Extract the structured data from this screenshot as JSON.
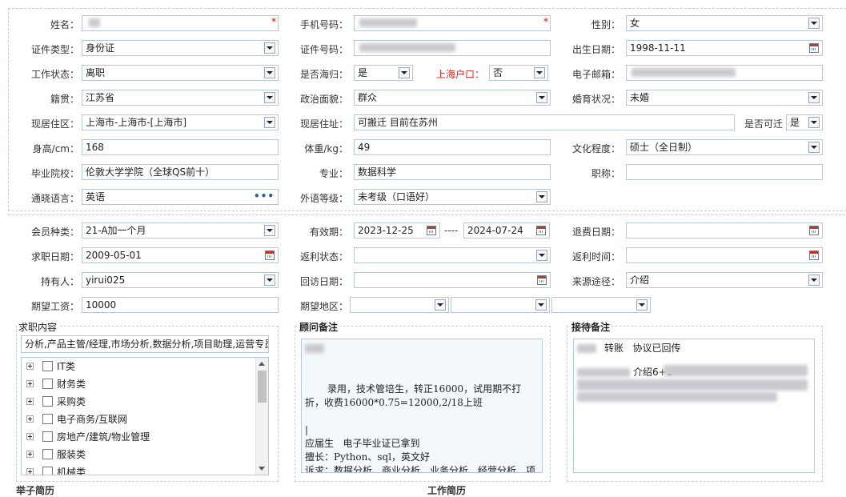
{
  "labels": {
    "name": "姓名：",
    "phone": "手机号码：",
    "gender": "性别：",
    "id_type": "证件类型：",
    "id_number": "证件号码：",
    "birthdate": "出生日期：",
    "work_status": "工作状态：",
    "returnee": "是否海归：",
    "shanghai_hukou": "上海户口：",
    "email": "电子邮箱：",
    "native_place": "籍贯：",
    "political_status": "政治面貌：",
    "marital_status": "婚育状况：",
    "current_area": "现居住区：",
    "current_address": "现居住址：",
    "relocatable": "是否可迁",
    "height": "身高/cm：",
    "weight": "体重/kg：",
    "education": "文化程度：",
    "school": "毕业院校：",
    "major": "专业：",
    "title": "职称：",
    "language": "通晓语言：",
    "foreign_level": "外语等级：",
    "member_type": "会员种类：",
    "validity": "有效期：",
    "refund_date": "退费日期：",
    "job_date": "求职日期：",
    "rebate_status": "返利状态：",
    "rebate_time": "返利时间：",
    "holder": "持有人：",
    "visit_date": "回访日期：",
    "source": "来源途径：",
    "salary": "期望工资：",
    "area": "期望地区：",
    "validity_sep": "----"
  },
  "values": {
    "name": "",
    "phone": "",
    "gender": "女",
    "id_type": "身份证",
    "id_number": "",
    "birthdate": "1998-11-11",
    "work_status": "离职",
    "returnee": "是",
    "shanghai_hukou": "否",
    "email": "",
    "native_place": "江苏省",
    "political_status": "群众",
    "marital_status": "未婚",
    "current_area": "上海市-上海市-[上海市]",
    "current_address": "可搬迁  目前在苏州",
    "relocatable": "是",
    "height": "168",
    "weight": "49",
    "education": "硕士（全日制）",
    "school": "伦敦大学学院（全球QS前十）",
    "major": "数据科学",
    "title": "",
    "language": "英语",
    "foreign_level": "未考级（口语好）",
    "member_type": "21-A加一个月",
    "validity_start": "2023-12-25",
    "validity_end": "2024-07-24",
    "refund_date": "",
    "job_date": "2009-05-01",
    "rebate_status": "",
    "rebate_time": "",
    "holder": "yirui025",
    "visit_date": "",
    "source": "介绍",
    "salary": "10000",
    "area_1": "",
    "area_2": "",
    "area_3": ""
  },
  "job_intent": {
    "title": "求职内容",
    "summary": "分析,产品主管/经理,市场分析,数据分析,项目助理,运营专员",
    "tree": [
      "IT类",
      "财务类",
      "采购类",
      "电子商务/互联网",
      "房地产/建筑/物业管理",
      "服装类",
      "机械类"
    ]
  },
  "consultant": {
    "title": "顾问备注",
    "text": "录用，技术管培生，转正16000，试用期不打折，收费16000*0.75=12000,2/18上班\n\n|\n应届生   电子毕业证已拿到\n擅长：Python、sql，英文好\n诉求：数据分析、商业分析、业务分析、经营分析、项目分析、产品运营、海外项目方向；甲乙方都可，行业不限制"
  },
  "reception": {
    "title": "接待备注",
    "line1": "转账   协议已回传",
    "line2": "介绍6+1"
  },
  "bottom": {
    "left": "举子简历",
    "mid": "工作简历"
  },
  "colors": {
    "border": "#b7c6d8",
    "required_star": "#dd0000",
    "hukou_label": "#e02020"
  }
}
